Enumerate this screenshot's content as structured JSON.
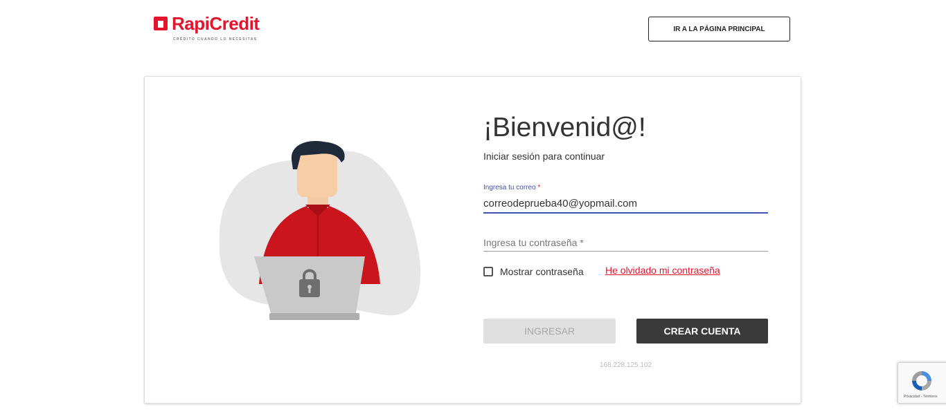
{
  "brand": {
    "name": "RapiCredit",
    "tagline": "CRÉDITO CUANDO LO NECESITAS",
    "color": "#e4142c"
  },
  "header": {
    "home_button_label": "IR A LA PÁGINA PRINCIPAL"
  },
  "login": {
    "title": "¡Bienvenid@!",
    "subtitle": "Iniciar sesión para continuar",
    "email_label": "Ingresa tu correo",
    "email_value": "correodeprueba40@yopmail.com",
    "password_placeholder": "Ingresa tu contraseña *",
    "required_mark": "*",
    "show_password_label": "Mostrar contraseña",
    "forgot_password_label": "He olvidado mi contraseña",
    "login_button_label": "INGRESAR",
    "create_account_button_label": "CREAR CUENTA",
    "ip_address": "168.228.125.102"
  },
  "recaptcha": {
    "links_text": "Privacidad - Términos",
    "icon": "recaptcha-icon"
  },
  "colors": {
    "accent": "#e4142c",
    "focus": "#3f51b5",
    "dark_button": "#3a3a3a",
    "disabled_button": "#e0e0e0"
  }
}
